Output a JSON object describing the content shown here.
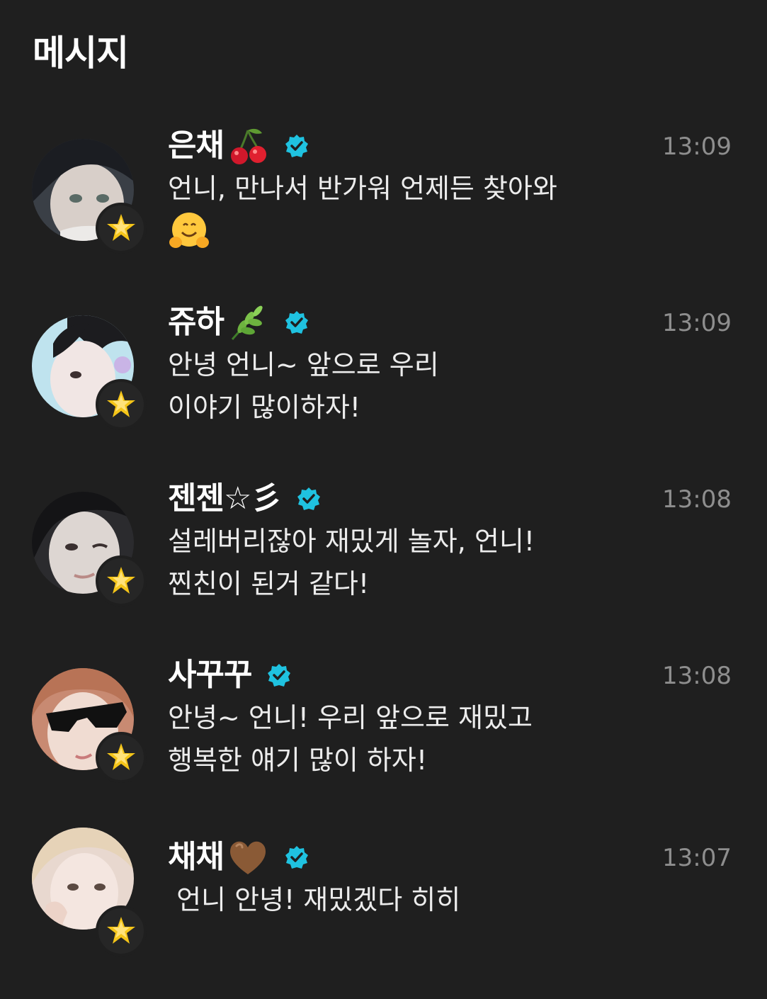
{
  "header": {
    "title": "메시지"
  },
  "messages": [
    {
      "name": "은채",
      "name_emoji": "cherries",
      "verified": true,
      "time": "13:09",
      "lines": [
        "언니, 만나서 반가워 언제든 찾아와"
      ],
      "trailing_emoji": "hugging-face",
      "avatar_tone": "#c9c2bd"
    },
    {
      "name": "쥬하",
      "name_emoji": "herb",
      "verified": true,
      "time": "13:09",
      "lines": [
        "안녕 언니~ 앞으로 우리",
        "이야기 많이하자!"
      ],
      "trailing_emoji": "",
      "avatar_tone": "#bfe3ee"
    },
    {
      "name": "젠젠☆彡",
      "name_emoji": "",
      "verified": true,
      "time": "13:08",
      "lines": [
        "설레버리잖아 재밌게 놀자, 언니!",
        "찐친이 된거 같다!"
      ],
      "trailing_emoji": "",
      "avatar_tone": "#d9d4d1"
    },
    {
      "name": "사꾸꾸",
      "name_emoji": "",
      "verified": true,
      "time": "13:08",
      "lines": [
        "안녕~ 언니! 우리 앞으로 재밌고",
        "행복한 얘기 많이 하자!"
      ],
      "trailing_emoji": "",
      "avatar_tone": "#e9d2c6"
    },
    {
      "name": "채채",
      "name_emoji": "brown-heart",
      "verified": true,
      "time": "13:07",
      "lines": [
        " 언니 안녕! 재밌겠다 히히"
      ],
      "trailing_emoji": "",
      "avatar_tone": "#efe2dc"
    }
  ],
  "colors": {
    "background": "#1f1f1f",
    "verified": "#1fc2e0",
    "timestamp": "#8e8e8e",
    "badge_star": "#f5c518"
  },
  "icons": {
    "verified": "verified-badge-icon",
    "badge": "star-badge-icon"
  }
}
